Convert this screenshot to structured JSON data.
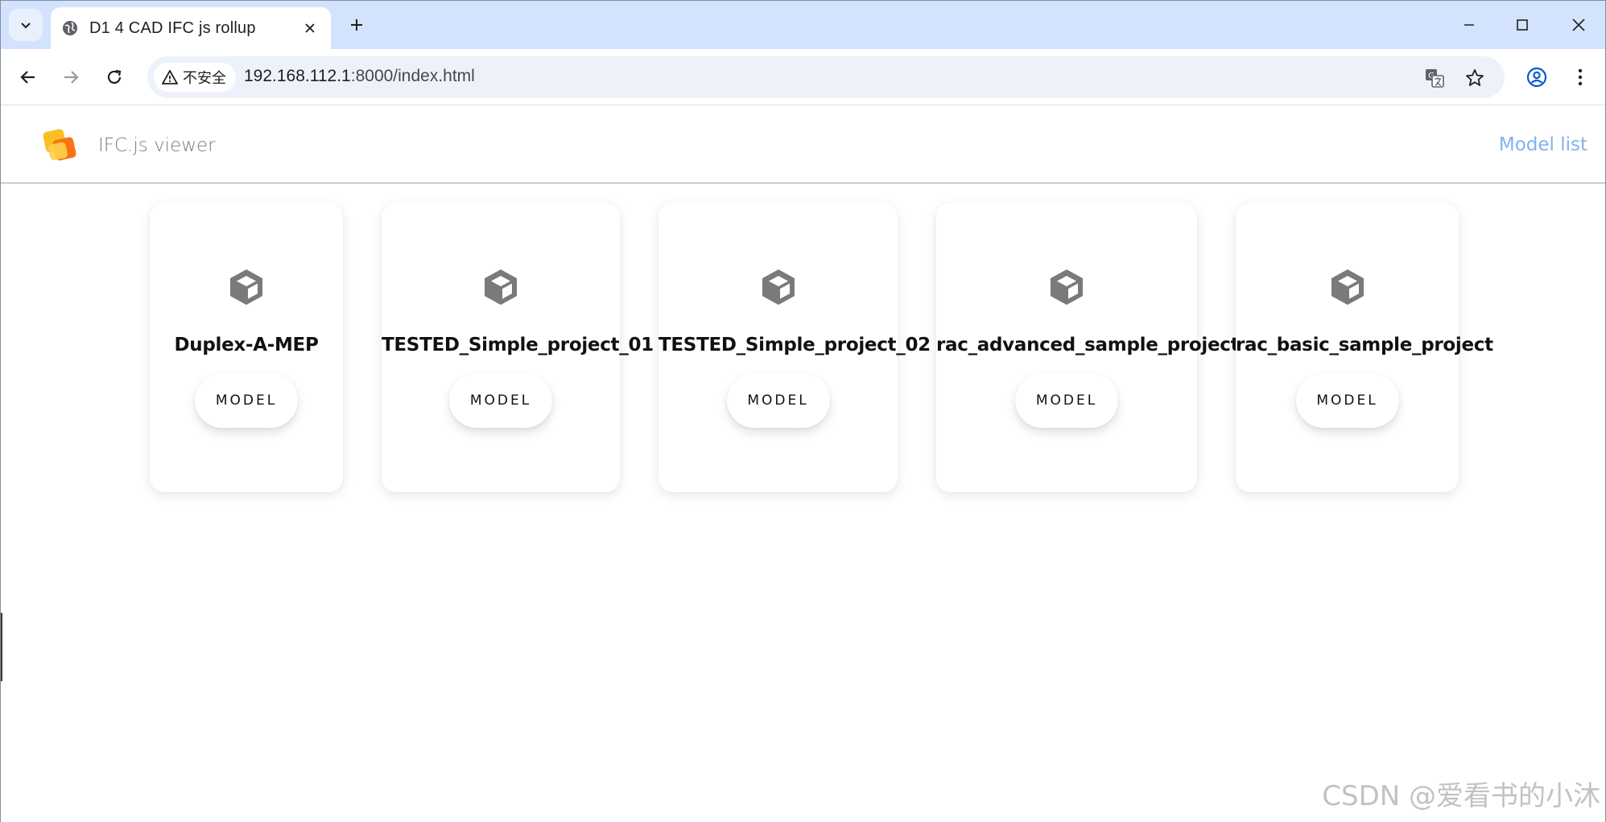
{
  "browser": {
    "tab_title": "D1 4 CAD IFC js rollup",
    "security_label": "不安全",
    "url_host": "192.168.112.1",
    "url_rest": ":8000/index.html"
  },
  "app": {
    "title": "IFC.js viewer",
    "nav_link": "Model list"
  },
  "models": [
    {
      "name": "Duplex-A-MEP",
      "button": "MODEL"
    },
    {
      "name": "TESTED_Simple_project_01",
      "button": "MODEL"
    },
    {
      "name": "TESTED_Simple_project_02",
      "button": "MODEL"
    },
    {
      "name": "rac_advanced_sample_project",
      "button": "MODEL"
    },
    {
      "name": "rac_basic_sample_project",
      "button": "MODEL"
    }
  ],
  "watermark": "CSDN @爱看书的小沐",
  "colors": {
    "tabbar_bg": "#d3e3fd",
    "omnibox_bg": "#edf2fa",
    "link": "#7fb2ef",
    "icon_gray": "#7a7a7a",
    "logo_yellow": "#fbbf24",
    "logo_orange": "#f97316"
  },
  "icons": {
    "tab_search": "chevron-down-icon",
    "favicon": "globe-icon",
    "back": "arrow-left-icon",
    "forward": "arrow-right-icon",
    "reload": "reload-icon",
    "warning": "warning-icon",
    "translate": "translate-icon",
    "bookmark": "star-icon",
    "profile": "account-circle-icon",
    "menu": "kebab-menu-icon",
    "model": "cube-icon"
  }
}
